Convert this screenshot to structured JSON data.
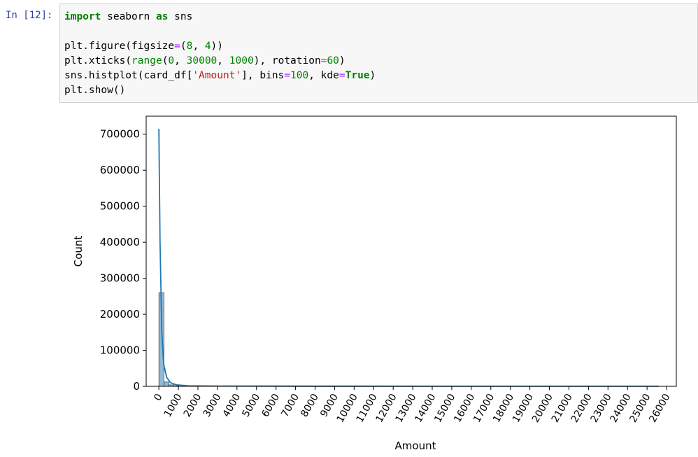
{
  "cell": {
    "prompt": "In [12]:",
    "code_lines": [
      [
        {
          "t": "import",
          "c": "kw"
        },
        {
          "t": " seaborn ",
          "c": ""
        },
        {
          "t": "as",
          "c": "kw"
        },
        {
          "t": " sns",
          "c": ""
        }
      ],
      [],
      [
        {
          "t": "plt.figure(figsize",
          "c": ""
        },
        {
          "t": "=",
          "c": "op"
        },
        {
          "t": "(",
          "c": ""
        },
        {
          "t": "8",
          "c": "num"
        },
        {
          "t": ", ",
          "c": ""
        },
        {
          "t": "4",
          "c": "num"
        },
        {
          "t": "))",
          "c": ""
        }
      ],
      [
        {
          "t": "plt.xticks(",
          "c": ""
        },
        {
          "t": "range",
          "c": "kw2"
        },
        {
          "t": "(",
          "c": ""
        },
        {
          "t": "0",
          "c": "num"
        },
        {
          "t": ", ",
          "c": ""
        },
        {
          "t": "30000",
          "c": "num"
        },
        {
          "t": ", ",
          "c": ""
        },
        {
          "t": "1000",
          "c": "num"
        },
        {
          "t": "), rotation",
          "c": ""
        },
        {
          "t": "=",
          "c": "op"
        },
        {
          "t": "60",
          "c": "num"
        },
        {
          "t": ")",
          "c": ""
        }
      ],
      [
        {
          "t": "sns.histplot(card_df[",
          "c": ""
        },
        {
          "t": "'Amount'",
          "c": "str"
        },
        {
          "t": "], bins",
          "c": ""
        },
        {
          "t": "=",
          "c": "op"
        },
        {
          "t": "100",
          "c": "num"
        },
        {
          "t": ", kde",
          "c": ""
        },
        {
          "t": "=",
          "c": "op"
        },
        {
          "t": "True",
          "c": "kw"
        },
        {
          "t": ")",
          "c": ""
        }
      ],
      [
        {
          "t": "plt.show()",
          "c": ""
        }
      ]
    ]
  },
  "chart_data": {
    "type": "bar",
    "xlabel": "Amount",
    "ylabel": "Count",
    "xlim": [
      -650,
      26500
    ],
    "ylim": [
      0,
      750000
    ],
    "xticks": [
      0,
      1000,
      2000,
      3000,
      4000,
      5000,
      6000,
      7000,
      8000,
      9000,
      10000,
      11000,
      12000,
      13000,
      14000,
      15000,
      16000,
      17000,
      18000,
      19000,
      20000,
      21000,
      22000,
      23000,
      24000,
      25000,
      26000
    ],
    "yticks": [
      0,
      100000,
      200000,
      300000,
      400000,
      500000,
      600000,
      700000
    ],
    "bins": [
      {
        "x0": 0,
        "x1": 257,
        "count": 260000
      },
      {
        "x0": 257,
        "x1": 514,
        "count": 12000
      },
      {
        "x0": 514,
        "x1": 771,
        "count": 4000
      },
      {
        "x0": 771,
        "x1": 1028,
        "count": 1500
      }
    ],
    "kde": [
      [
        0,
        715000
      ],
      [
        60,
        400000
      ],
      [
        150,
        150000
      ],
      [
        250,
        60000
      ],
      [
        400,
        25000
      ],
      [
        600,
        10000
      ],
      [
        900,
        4000
      ],
      [
        1500,
        1500
      ],
      [
        3000,
        800
      ],
      [
        8000,
        400
      ],
      [
        15000,
        300
      ],
      [
        20000,
        300
      ],
      [
        25600,
        300
      ]
    ],
    "bar_color": "#1f77b4",
    "line_color": "#1f77b4"
  }
}
